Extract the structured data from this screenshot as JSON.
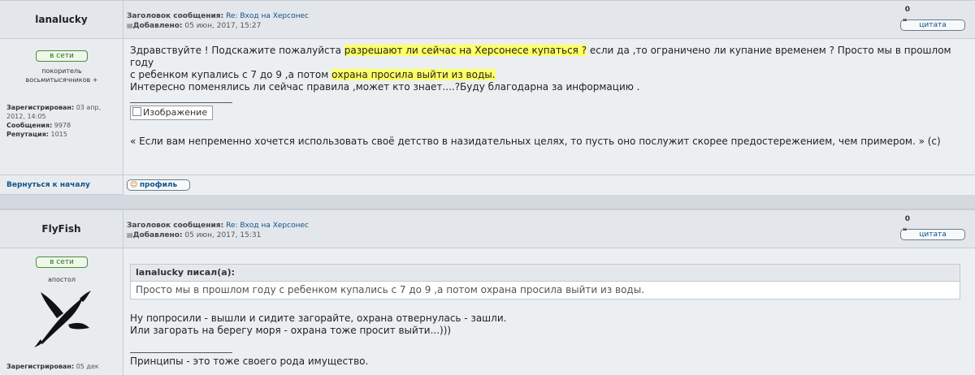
{
  "posts": [
    {
      "author": "lanalucky",
      "subject_label": "Заголовок сообщения:",
      "subject_link": "Re: Вход на Херсонес",
      "added_label": "Добавлено:",
      "added_value": "05 июн, 2017, 15:27",
      "counter": "0",
      "quote_button": "цитата",
      "online": "в сети",
      "rank": "покоритель восьмитысячников +",
      "registered_label": "Зарегистрирован:",
      "registered_value": "03 апр, 2012, 14:05",
      "messages_label": "Сообщения:",
      "messages_value": "9978",
      "reputation_label": "Репутация:",
      "reputation_value": "1015",
      "text_line1_a": "Здравствуйте ! Подскажите пожалуйста ",
      "text_line1_hl": "разрешают ли сейчас на Херсонесе купаться ?",
      "text_line1_b": " если да ,то ограничено ли купание временем ? Просто мы в прошлом году",
      "text_line2_a": "с ребенком купались с 7 до 9 ,а потом ",
      "text_line2_hl": "охрана просила выйти из воды.",
      "text_line3": "Интересно поменялись ли сейчас правила ,может кто знает....?Буду благодарна за информацию .",
      "image_alt": "Изображение",
      "signature": "« Если вам непременно хочется использовать своё детство в назидательных целях, то пусть оно послужит скорее предостережением, чем примером. » (с)",
      "back_link": "Вернуться к началу",
      "profile_button": "профиль"
    },
    {
      "author": "FlyFish",
      "subject_label": "Заголовок сообщения:",
      "subject_link": "Re: Вход на Херсонес",
      "added_label": "Добавлено:",
      "added_value": "05 июн, 2017, 15:31",
      "counter": "0",
      "quote_button": "цитата",
      "online": "в сети",
      "rank": "апостол",
      "registered_label": "Зарегистрирован:",
      "registered_value": "05 дек",
      "quote_author": "lanalucky писал(а):",
      "quote_text": "Просто мы в прошлом году с ребенком купались с 7 до 9 ,а потом охрана просила выйти из воды.",
      "text_line1": "Ну попросили - вышли и сидите загорайте, охрана отвернулась - зашли.",
      "text_line2": "Или загорать на берегу моря - охрана тоже просит выйти...)))",
      "signature": "Принципы - это тоже своего рода имущество."
    }
  ],
  "colors": {
    "highlight": "#ffff66",
    "link": "#105289",
    "online": "#2a6f1a"
  },
  "icons": [
    "quote-icon",
    "profile-icon",
    "post-icon",
    "image-icon",
    "avatar-dragonfish"
  ]
}
